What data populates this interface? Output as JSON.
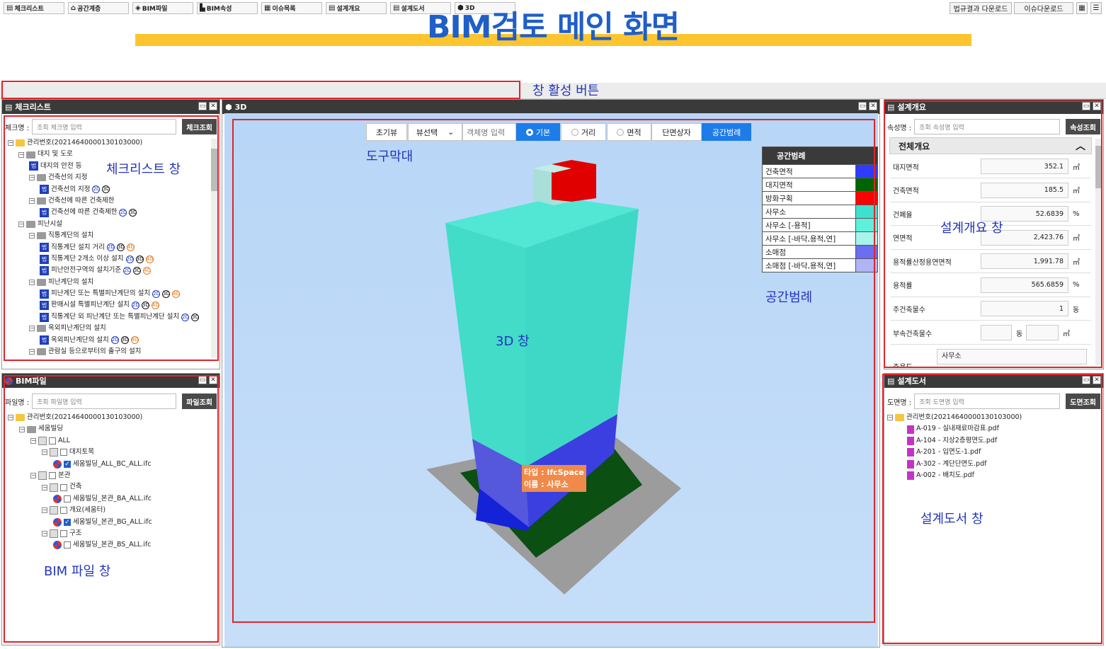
{
  "heading": "BIM검토 메인 화면",
  "annotations": {
    "window_buttons": "창 활성 버튼",
    "checklist": "체크리스트 창",
    "toolbar": "도구막대",
    "space_legend": "공간범례",
    "viewer": "3D 창",
    "overview": "설계개요 창",
    "bim_files": "BIM 파일 창",
    "drawings": "설계도서 창"
  },
  "topbar": {
    "buttons": [
      "체크리스트",
      "공간계층",
      "BIM파일",
      "BIM속성",
      "이슈목록",
      "설계개요",
      "설계도서",
      "3D"
    ],
    "right": [
      "법규결과 다운로드",
      "이슈다운로드"
    ]
  },
  "checklist": {
    "title": "체크리스트",
    "search_label": "체크명 :",
    "search_placeholder": "조회 체크명 입력",
    "search_button": "체크조회",
    "tree": [
      {
        "d": 0,
        "t": "root",
        "label": "관리번호(20214640000130103000)"
      },
      {
        "d": 1,
        "t": "folder",
        "label": "대지 및 도로"
      },
      {
        "d": 2,
        "t": "law",
        "label": "대지의 안전 등",
        "b": []
      },
      {
        "d": 2,
        "t": "folder",
        "label": "건축선의 지정"
      },
      {
        "d": 3,
        "t": "law",
        "label": "건축선의 지정",
        "b": [
          "2",
          "3"
        ]
      },
      {
        "d": 2,
        "t": "folder",
        "label": "건축선에 따른 건축제한"
      },
      {
        "d": 3,
        "t": "law",
        "label": "건축선에 따른 건축제한",
        "b": [
          "2",
          "3"
        ]
      },
      {
        "d": 1,
        "t": "folder",
        "label": "피난시설"
      },
      {
        "d": 2,
        "t": "folder",
        "label": "직통계단의 설치"
      },
      {
        "d": 3,
        "t": "law",
        "label": "직통계단 설치 거리",
        "b": [
          "2",
          "3",
          "4"
        ]
      },
      {
        "d": 3,
        "t": "law",
        "label": "직통계단 2개소 이상 설치",
        "b": [
          "2",
          "3",
          "4"
        ]
      },
      {
        "d": 3,
        "t": "law",
        "label": "피난안전구역의 설치기준",
        "b": [
          "2",
          "3",
          "4"
        ]
      },
      {
        "d": 2,
        "t": "folder",
        "label": "피난계단의 설치"
      },
      {
        "d": 3,
        "t": "law",
        "label": "피난계단 또는 특별피난계단의 설치",
        "b": [
          "2",
          "3",
          "4"
        ]
      },
      {
        "d": 3,
        "t": "law",
        "label": "판매시설 특별피난계단 설치",
        "b": [
          "2",
          "3",
          "4"
        ]
      },
      {
        "d": 3,
        "t": "law",
        "label": "직통계단 외 피난계단 또는 특별피난계단 설치",
        "b": [
          "2",
          "3"
        ]
      },
      {
        "d": 2,
        "t": "folder",
        "label": "옥외피난계단의 설치"
      },
      {
        "d": 3,
        "t": "law",
        "label": "옥외피난계단의 설치",
        "b": [
          "2",
          "3",
          "4"
        ]
      },
      {
        "d": 2,
        "t": "folder",
        "label": "관람실 등으로부터의 출구의 설치"
      }
    ]
  },
  "bimfile": {
    "title": "BIM파일",
    "search_label": "파일명 :",
    "search_placeholder": "조회 파일명 입력",
    "search_button": "파일조회",
    "tree": [
      {
        "d": 0,
        "t": "root",
        "label": "관리번호(20214640000130103000)"
      },
      {
        "d": 1,
        "t": "folder",
        "label": "세움빌딩"
      },
      {
        "d": 2,
        "t": "bld",
        "label": "ALL",
        "c": false
      },
      {
        "d": 3,
        "t": "doc",
        "label": "대지토목",
        "c": false
      },
      {
        "d": 4,
        "t": "ifc",
        "label": "세움빌딩_ALL_BC_ALL.ifc",
        "c": true
      },
      {
        "d": 2,
        "t": "bld",
        "label": "본관",
        "c": false
      },
      {
        "d": 3,
        "t": "doc",
        "label": "건축",
        "c": false
      },
      {
        "d": 4,
        "t": "ifc",
        "label": "세움빌딩_본관_BA_ALL.ifc",
        "c": false
      },
      {
        "d": 3,
        "t": "doc",
        "label": "개요(세움터)",
        "c": false
      },
      {
        "d": 4,
        "t": "ifc",
        "label": "세움빌딩_본관_BG_ALL.ifc",
        "c": true
      },
      {
        "d": 3,
        "t": "doc",
        "label": "구조",
        "c": false
      },
      {
        "d": 4,
        "t": "ifc",
        "label": "세움빌딩_본관_BS_ALL.ifc",
        "c": false
      }
    ]
  },
  "viewer": {
    "title": "3D",
    "tools": [
      "초기뷰",
      "뷰선택",
      "객체명 입력",
      "기본",
      "거리",
      "면적",
      "단면상자",
      "공간범례"
    ],
    "tag": [
      "타입 : IfcSpace",
      "이름 : 사무소"
    ],
    "legend_title": "공간범례",
    "legend": [
      {
        "name": "건축면적",
        "color": "#2f3cff"
      },
      {
        "name": "대지면적",
        "color": "#006400"
      },
      {
        "name": "방화구획",
        "color": "#ff0000"
      },
      {
        "name": "사무소",
        "color": "#40e0d0"
      },
      {
        "name": "사무소 [-용적]",
        "color": "#5ef0dc"
      },
      {
        "name": "사무소 [-바닥,용적,연]",
        "color": "#a6f4ec"
      },
      {
        "name": "소매점",
        "color": "#6a6ef0"
      },
      {
        "name": "소매점 [-바닥,용적,연]",
        "color": "#b0b4f4"
      }
    ]
  },
  "overview": {
    "title": "설계개요",
    "search_label": "속성명 :",
    "search_placeholder": "조회 속성명 입력",
    "search_button": "속성조회",
    "section": "전체개요",
    "rows": [
      {
        "label": "대지면적",
        "value": "352.1",
        "unit": "㎡"
      },
      {
        "label": "건축면적",
        "value": "185.5",
        "unit": "㎡"
      },
      {
        "label": "건폐율",
        "value": "52.6839",
        "unit": "%"
      },
      {
        "label": "연면적",
        "value": "2,423.76",
        "unit": "㎡"
      },
      {
        "label": "용적률산정용연면적",
        "value": "1,991.78",
        "unit": "㎡"
      },
      {
        "label": "용적률",
        "value": "565.6859",
        "unit": "%"
      },
      {
        "label": "주건축물수",
        "value": "1",
        "unit": "동"
      }
    ],
    "sub_label": "부속건축물수",
    "sub_unit1": "동",
    "sub_unit2": "㎡",
    "use_label": "주용도",
    "use_value": "사무소"
  },
  "drawings": {
    "title": "설계도서",
    "search_label": "도면명 :",
    "search_placeholder": "조회 도면명 입력",
    "search_button": "도면조회",
    "root": "관리번호(20214640000130103000)",
    "files": [
      "A-019 - 실내재료마감표.pdf",
      "A-104 - 지상2층평면도.pdf",
      "A-201 - 입면도-1.pdf",
      "A-302 - 계단단면도.pdf",
      "A-002 - 배치도.pdf"
    ]
  }
}
